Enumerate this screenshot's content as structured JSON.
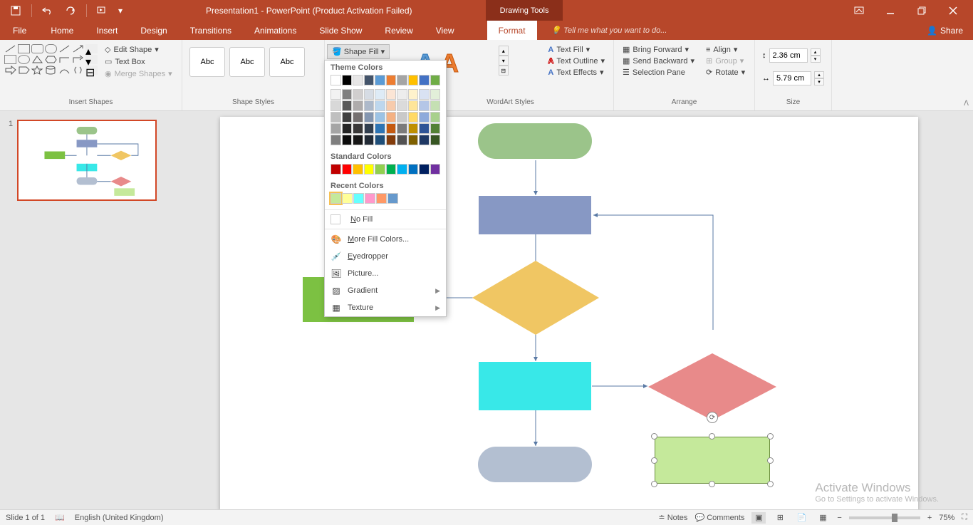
{
  "title": "Presentation1 - PowerPoint (Product Activation Failed)",
  "context_tab": "Drawing Tools",
  "tabs": {
    "file": "File",
    "home": "Home",
    "insert": "Insert",
    "design": "Design",
    "transitions": "Transitions",
    "animations": "Animations",
    "slideshow": "Slide Show",
    "review": "Review",
    "view": "View",
    "format": "Format"
  },
  "tell_me": "Tell me what you want to do...",
  "share": "Share",
  "groups": {
    "insert_shapes": "Insert Shapes",
    "shape_styles": "Shape Styles",
    "wordart_styles": "WordArt Styles",
    "arrange": "Arrange",
    "size": "Size"
  },
  "insert": {
    "edit_shape": "Edit Shape",
    "text_box": "Text Box",
    "merge_shapes": "Merge Shapes"
  },
  "style_thumb_label": "Abc",
  "shape_fill_label": "Shape Fill",
  "text_group": {
    "text_fill": "Text Fill",
    "text_outline": "Text Outline",
    "text_effects": "Text Effects"
  },
  "arrange_group": {
    "bring_forward": "Bring Forward",
    "send_backward": "Send Backward",
    "selection_pane": "Selection Pane",
    "align": "Align",
    "group": "Group",
    "rotate": "Rotate"
  },
  "size": {
    "height": "2.36 cm",
    "width": "5.79 cm"
  },
  "dropdown": {
    "theme_colors": "Theme Colors",
    "standard_colors": "Standard Colors",
    "recent_colors": "Recent Colors",
    "no_fill": "No Fill",
    "more_colors": "More Fill Colors...",
    "eyedropper": "Eyedropper",
    "picture": "Picture...",
    "gradient": "Gradient",
    "texture": "Texture",
    "theme_row1": [
      "#ffffff",
      "#000000",
      "#e7e6e6",
      "#44546a",
      "#5b9bd5",
      "#ed7d31",
      "#a5a5a5",
      "#ffc000",
      "#4472c4",
      "#70ad47"
    ],
    "theme_shades": [
      [
        "#f2f2f2",
        "#7f7f7f",
        "#d0cece",
        "#d6dce4",
        "#deebf6",
        "#fbe5d5",
        "#ededed",
        "#fff2cc",
        "#d9e2f3",
        "#e2efd9"
      ],
      [
        "#d8d8d8",
        "#595959",
        "#aeabab",
        "#adb9ca",
        "#bdd7ee",
        "#f7cbac",
        "#dbdbdb",
        "#fee599",
        "#b4c6e7",
        "#c5e0b3"
      ],
      [
        "#bfbfbf",
        "#3f3f3f",
        "#757070",
        "#8496b0",
        "#9cc3e5",
        "#f4b183",
        "#c9c9c9",
        "#ffd965",
        "#8eaadb",
        "#a8d08d"
      ],
      [
        "#a5a5a5",
        "#262626",
        "#3a3838",
        "#323f4f",
        "#2e75b5",
        "#c55a11",
        "#7b7b7b",
        "#bf9000",
        "#2f5496",
        "#538135"
      ],
      [
        "#7f7f7f",
        "#0c0c0c",
        "#171616",
        "#222a35",
        "#1e4e79",
        "#833c0b",
        "#525252",
        "#7f6000",
        "#1f3864",
        "#375623"
      ]
    ],
    "standard_row": [
      "#c00000",
      "#ff0000",
      "#ffc000",
      "#ffff00",
      "#92d050",
      "#00b050",
      "#00b0f0",
      "#0070c0",
      "#002060",
      "#7030a0"
    ],
    "recent_row": [
      "#c5e99b",
      "#ffff99",
      "#66ffff",
      "#ff99cc",
      "#ff9966",
      "#6699cc"
    ]
  },
  "thumb_number": "1",
  "status": {
    "slide": "Slide 1 of 1",
    "language": "English (United Kingdom)",
    "notes": "Notes",
    "comments": "Comments",
    "zoom": "75%"
  },
  "watermark": {
    "title": "Activate Windows",
    "sub": "Go to Settings to activate Windows."
  }
}
